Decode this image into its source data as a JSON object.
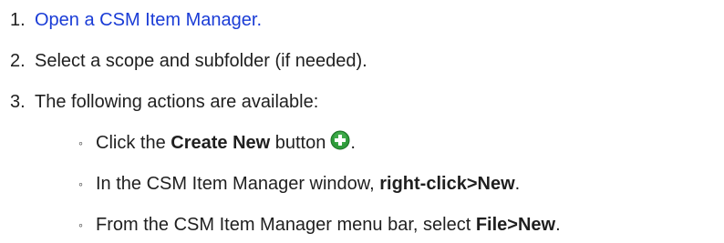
{
  "steps": [
    {
      "number": "1.",
      "link_text": "Open a CSM Item Manager."
    },
    {
      "number": "2.",
      "text": "Select a scope and subfolder (if needed)."
    },
    {
      "number": "3.",
      "text": "The following actions are available:"
    }
  ],
  "sub_items": [
    {
      "bullet": "◦",
      "before": "Click the ",
      "bold": "Create New",
      "after": " button",
      "icon": "create-new-plus-icon",
      "end": "."
    },
    {
      "bullet": "◦",
      "before": "In the CSM Item Manager window, ",
      "bold": "right-click>New",
      "end": "."
    },
    {
      "bullet": "◦",
      "before": "From the CSM Item Manager menu bar, select ",
      "bold": "File>New",
      "end": "."
    }
  ],
  "colors": {
    "link": "#1a3cd6",
    "icon_green": "#2e9b3a",
    "text": "#1f1f1f"
  }
}
